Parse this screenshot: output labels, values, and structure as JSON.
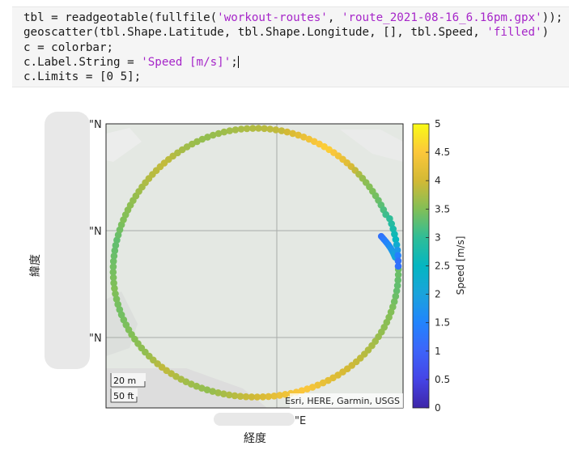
{
  "code": {
    "lines": [
      [
        {
          "t": "tbl = readgeotable(fullfile("
        },
        {
          "t": "'workout-routes'",
          "s": 1
        },
        {
          "t": ", "
        },
        {
          "t": "'route_2021-08-16_6.16pm.gpx'",
          "s": 1
        },
        {
          "t": "));"
        }
      ],
      [
        {
          "t": "geoscatter(tbl.Shape.Latitude, tbl.Shape.Longitude, [], tbl.Speed, "
        },
        {
          "t": "'filled'",
          "s": 1
        },
        {
          "t": ")"
        }
      ],
      [
        {
          "t": "c = colorbar;"
        }
      ],
      [
        {
          "t": "c.Label.String = "
        },
        {
          "t": "'Speed [m/s]'",
          "s": 1
        },
        {
          "t": ";"
        }
      ],
      [
        {
          "t": "c.Limits = [0 5];"
        }
      ]
    ]
  },
  "figure": {
    "lat_tick_labels": [
      "\"N",
      "\"N",
      "\"N"
    ],
    "lon_tick_label": "\"E",
    "ylabel": "緯度",
    "xlabel": "経度",
    "attribution": "Esri, HERE, Garmin, USGS",
    "scalebar": {
      "metric": "20 m",
      "imperial": "50 ft"
    },
    "basemap_colors": {
      "land": "#e4e8e3",
      "grid": "#a9aca9"
    }
  },
  "chart_data": {
    "type": "scatter",
    "series": [
      {
        "color_variable": "Speed",
        "path": "closed loop route (approximately circular)",
        "points": [
          {
            "angle_deg": 0,
            "speed": 3.4
          },
          {
            "angle_deg": 10,
            "speed": 3.3
          },
          {
            "angle_deg": 20,
            "speed": 3.5
          },
          {
            "angle_deg": 30,
            "speed": 3.6
          },
          {
            "angle_deg": 40,
            "speed": 3.8
          },
          {
            "angle_deg": 50,
            "speed": 4.0
          },
          {
            "angle_deg": 60,
            "speed": 4.2
          },
          {
            "angle_deg": 70,
            "speed": 4.5
          },
          {
            "angle_deg": 80,
            "speed": 4.3
          },
          {
            "angle_deg": 90,
            "speed": 4.0
          },
          {
            "angle_deg": 100,
            "speed": 3.8
          },
          {
            "angle_deg": 110,
            "speed": 3.6
          },
          {
            "angle_deg": 120,
            "speed": 3.7
          },
          {
            "angle_deg": 130,
            "speed": 3.9
          },
          {
            "angle_deg": 140,
            "speed": 3.6
          },
          {
            "angle_deg": 150,
            "speed": 3.5
          },
          {
            "angle_deg": 160,
            "speed": 3.4
          },
          {
            "angle_deg": 170,
            "speed": 3.5
          },
          {
            "angle_deg": 180,
            "speed": 3.4
          },
          {
            "angle_deg": 190,
            "speed": 3.3
          },
          {
            "angle_deg": 200,
            "speed": 3.5
          },
          {
            "angle_deg": 210,
            "speed": 3.6
          },
          {
            "angle_deg": 220,
            "speed": 3.8
          },
          {
            "angle_deg": 230,
            "speed": 3.9
          },
          {
            "angle_deg": 240,
            "speed": 3.7
          },
          {
            "angle_deg": 250,
            "speed": 3.6
          },
          {
            "angle_deg": 260,
            "speed": 3.7
          },
          {
            "angle_deg": 270,
            "speed": 3.8
          },
          {
            "angle_deg": 280,
            "speed": 3.9
          },
          {
            "angle_deg": 290,
            "speed": 4.3
          },
          {
            "angle_deg": 300,
            "speed": 4.6
          },
          {
            "angle_deg": 310,
            "speed": 4.2
          },
          {
            "angle_deg": 320,
            "speed": 3.6
          },
          {
            "angle_deg": 330,
            "speed": 3.4
          },
          {
            "angle_deg": 340,
            "speed": 3.0
          },
          {
            "angle_deg": 350,
            "speed": 2.5
          },
          {
            "angle_deg": 355,
            "speed": 1.6
          },
          {
            "angle_deg": 358,
            "speed": 1.2
          }
        ]
      }
    ],
    "colorbar": {
      "label": "Speed [m/s]",
      "limits": [
        0,
        5
      ],
      "ticks": [
        "0",
        "0.5",
        "1",
        "1.5",
        "2",
        "2.5",
        "3",
        "3.5",
        "4",
        "4.5",
        "5"
      ],
      "colormap": "parula"
    }
  }
}
